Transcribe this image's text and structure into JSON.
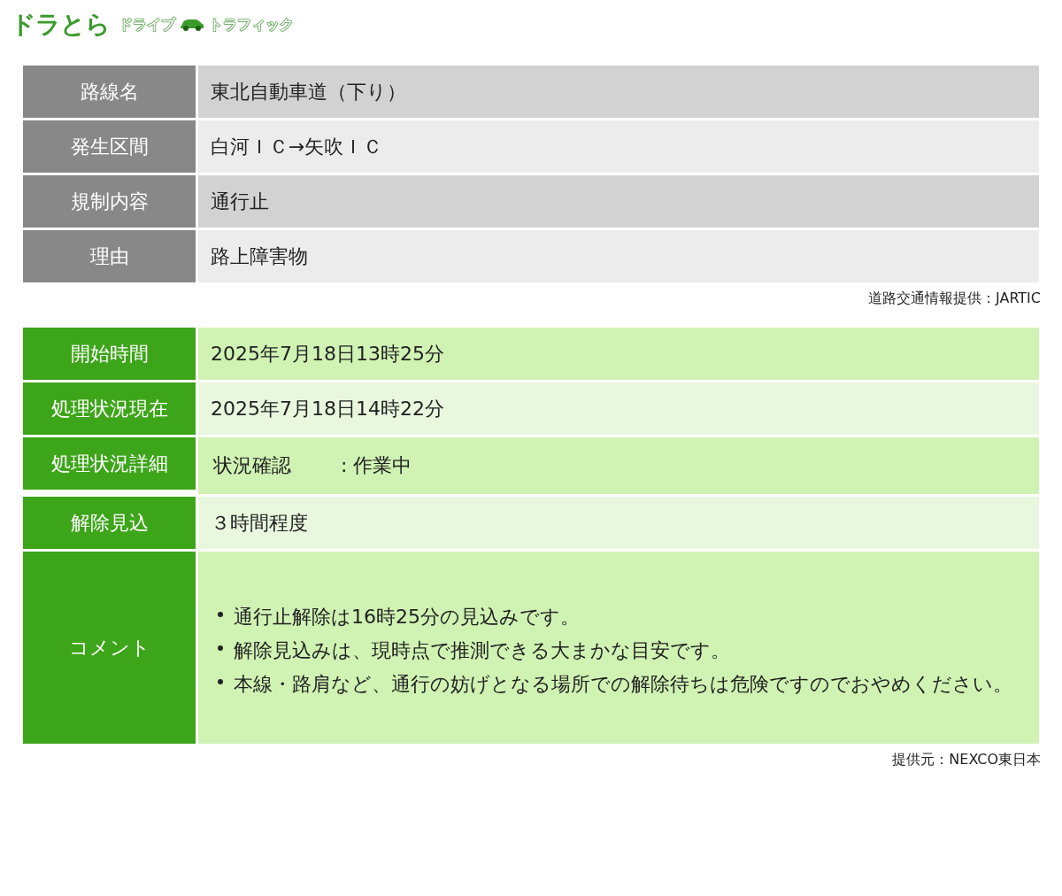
{
  "logo": {
    "main": "ドラとら",
    "sub_left": "ドライブ",
    "sub_right": "トラフィック"
  },
  "regulation": {
    "rows": [
      {
        "label": "路線名",
        "value": "東北自動車道（下り）"
      },
      {
        "label": "発生区間",
        "value": "白河ＩＣ→矢吹ＩＣ"
      },
      {
        "label": "規制内容",
        "value": "通行止"
      },
      {
        "label": "理由",
        "value": "路上障害物"
      }
    ],
    "source": "道路交通情報提供：JARTIC"
  },
  "status": {
    "rows": [
      {
        "kind": "text",
        "label": "開始時間",
        "value": "2025年7月18日13時25分"
      },
      {
        "kind": "text",
        "label": "処理状況現在",
        "value": "2025年7月18日14時22分"
      },
      {
        "kind": "pair",
        "label": "処理状況詳細",
        "key": "状況確認",
        "value": ": 作業中"
      },
      {
        "kind": "text",
        "label": "解除見込",
        "value": "３時間程度"
      },
      {
        "kind": "list",
        "label": "コメント",
        "items": [
          "通行止解除は16時25分の見込みです。",
          "解除見込みは、現時点で推測できる大まかな目安です。",
          "本線・路肩など、通行の妨げとなる場所での解除待ちは危険ですのでおやめください。"
        ]
      }
    ],
    "source": "提供元：NEXCO東日本"
  }
}
